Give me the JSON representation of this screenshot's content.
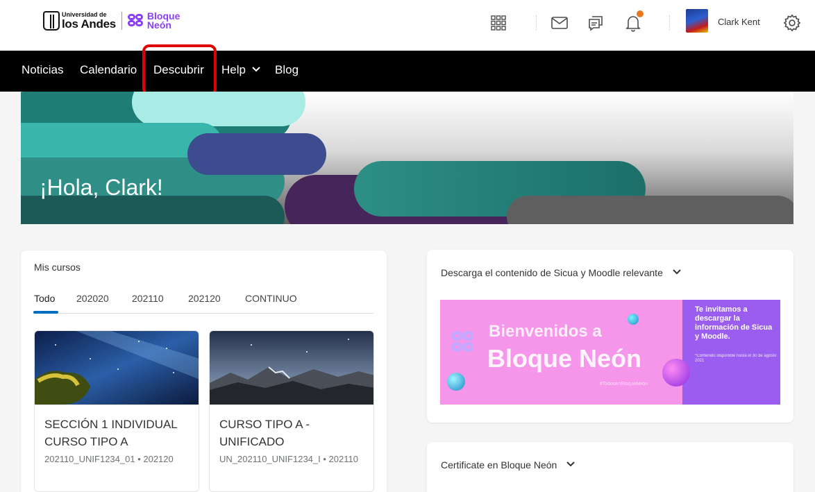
{
  "header": {
    "logo_uni_small": "Universidad de",
    "logo_uni_big": "los Andes",
    "logo_neon_1": "Bloque",
    "logo_neon_2": "Neón",
    "icons": [
      "apps-grid-icon",
      "mail-icon",
      "chat-icon",
      "bell-icon",
      "gear-icon"
    ],
    "username": "Clark Kent",
    "notification_color": "#e87722"
  },
  "nav": {
    "items": [
      {
        "label": "Noticias"
      },
      {
        "label": "Calendario"
      },
      {
        "label": "Descubrir"
      },
      {
        "label": "Help"
      },
      {
        "label": "Blog"
      }
    ],
    "highlight_color": "#e10000"
  },
  "hero": {
    "title": "¡Hola, Clark!"
  },
  "my_courses": {
    "title": "Mis cursos",
    "tabs": [
      {
        "label": "Todo"
      },
      {
        "label": "202020"
      },
      {
        "label": "202110"
      },
      {
        "label": "202120"
      },
      {
        "label": "CONTINUO"
      }
    ],
    "active_tab": "Todo",
    "accent": "#006fbf",
    "courses": [
      {
        "name": "SECCIÓN 1 INDIVIDUAL CURSO TIPO A",
        "code": "202110_UNIF1234_01 • 202120"
      },
      {
        "name": "CURSO TIPO A - UNIFICADO",
        "code": "UN_202110_UNIF1234_I • 202110"
      }
    ]
  },
  "widgets": {
    "download_title": "Descarga el contenido de Sicua y Moodle relevante",
    "banner": {
      "line1": "Bienvenidos a",
      "line2": "Bloque Neón",
      "tag": "#TodosenBloqueNeón",
      "side_text": "Te invitamos a descargar la información de Sicua y Moodle.",
      "note": "*Contenido disponible hasta el 30 de agosto 2021",
      "colors": {
        "pink": "#f596ea",
        "purple": "#9b5cf0"
      }
    },
    "certificate_title": "Certificate en Bloque Neón"
  }
}
